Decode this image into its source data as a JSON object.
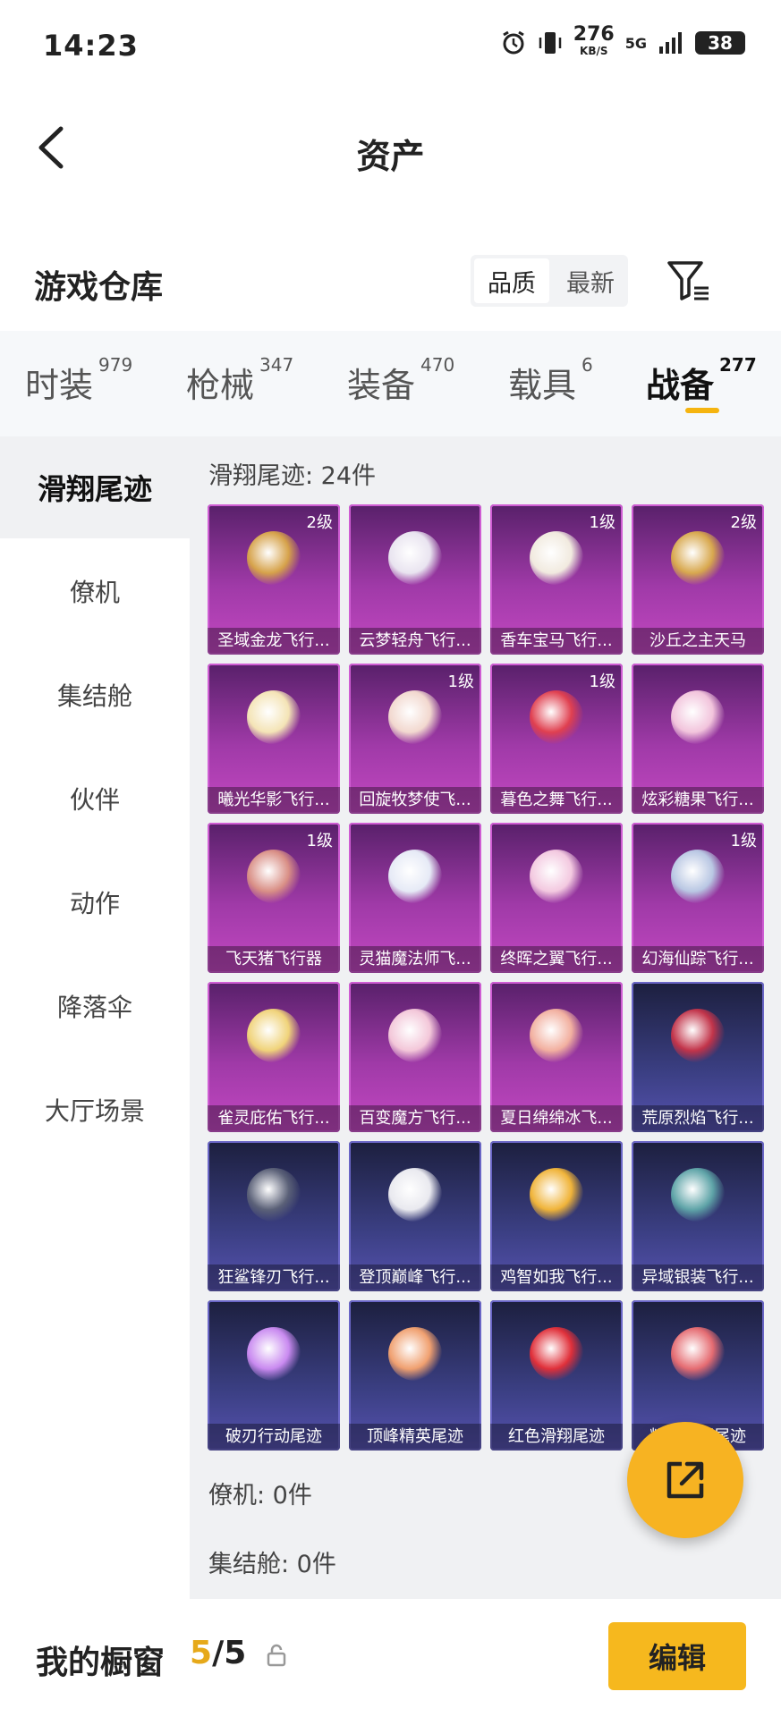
{
  "status_bar": {
    "time": "14:23",
    "net_speed": "276",
    "net_unit": "KB/S",
    "signal": "5G",
    "battery": "38"
  },
  "header": {
    "title": "资产"
  },
  "warehouse": {
    "title": "游戏仓库",
    "sort_options": [
      "品质",
      "最新"
    ],
    "sort_active": "品质"
  },
  "tabs": [
    {
      "label": "时装",
      "count": "979"
    },
    {
      "label": "枪械",
      "count": "347"
    },
    {
      "label": "装备",
      "count": "470"
    },
    {
      "label": "载具",
      "count": "6"
    },
    {
      "label": "战备",
      "count": "277"
    }
  ],
  "active_tab": "战备",
  "sidebar": [
    "滑翔尾迹",
    "僚机",
    "集结舱",
    "伙伴",
    "动作",
    "降落伞",
    "大厅场景"
  ],
  "sections": {
    "glide": "滑翔尾迹: 24件",
    "wingman": "僚机: 0件",
    "assembly": "集结舱: 0件"
  },
  "items": [
    {
      "name": "圣域金龙飞行...",
      "level": "2级",
      "rarity": "purple",
      "color": "#d6a24a"
    },
    {
      "name": "云梦轻舟飞行...",
      "level": "",
      "rarity": "purple",
      "color": "#e9e4f0"
    },
    {
      "name": "香车宝马飞行...",
      "level": "1级",
      "rarity": "purple",
      "color": "#f1eadf"
    },
    {
      "name": "沙丘之主天马",
      "level": "2级",
      "rarity": "purple",
      "color": "#d8a84e"
    },
    {
      "name": "曦光华影飞行...",
      "level": "",
      "rarity": "purple",
      "color": "#f4e4b6"
    },
    {
      "name": "回旋牧梦使飞...",
      "level": "1级",
      "rarity": "purple",
      "color": "#f2d8cf"
    },
    {
      "name": "暮色之舞飞行...",
      "level": "1级",
      "rarity": "purple",
      "color": "#e04050"
    },
    {
      "name": "炫彩糖果飞行...",
      "level": "",
      "rarity": "purple",
      "color": "#f2c4dc"
    },
    {
      "name": "飞天猪飞行器",
      "level": "1级",
      "rarity": "purple",
      "color": "#d98f86"
    },
    {
      "name": "灵猫魔法师飞...",
      "level": "",
      "rarity": "purple",
      "color": "#e6eaf6"
    },
    {
      "name": "终晖之翼飞行...",
      "level": "",
      "rarity": "purple",
      "color": "#f3c9e0"
    },
    {
      "name": "幻海仙踪飞行...",
      "level": "1级",
      "rarity": "purple",
      "color": "#b9c7e3"
    },
    {
      "name": "雀灵庇佑飞行...",
      "level": "",
      "rarity": "purple",
      "color": "#f0d37a"
    },
    {
      "name": "百变魔方飞行...",
      "level": "",
      "rarity": "purple",
      "color": "#f3c7d9"
    },
    {
      "name": "夏日绵绵冰飞...",
      "level": "",
      "rarity": "purple",
      "color": "#f2b0a0"
    },
    {
      "name": "荒原烈焰飞行...",
      "level": "",
      "rarity": "blue",
      "color": "#c2344a"
    },
    {
      "name": "狂鲨锋刃飞行...",
      "level": "",
      "rarity": "blue",
      "color": "#5b6178"
    },
    {
      "name": "登顶巅峰飞行...",
      "level": "",
      "rarity": "blue",
      "color": "#e9e9ef"
    },
    {
      "name": "鸡智如我飞行...",
      "level": "",
      "rarity": "blue",
      "color": "#f0b43a"
    },
    {
      "name": "异域银装飞行...",
      "level": "",
      "rarity": "blue",
      "color": "#5fa4a8"
    },
    {
      "name": "破刃行动尾迹",
      "level": "",
      "rarity": "blue",
      "color": "#c98af0"
    },
    {
      "name": "顶峰精英尾迹",
      "level": "",
      "rarity": "blue",
      "color": "#f0a070"
    },
    {
      "name": "红色滑翔尾迹",
      "level": "",
      "rarity": "blue",
      "color": "#e0303a"
    },
    {
      "name": "粉色滑翔尾迹",
      "level": "",
      "rarity": "blue",
      "color": "#e56c72"
    }
  ],
  "bottom_bar": {
    "label": "我的橱窗",
    "count_current": "5",
    "count_total": "/5",
    "edit_label": "编辑"
  },
  "icons": [
    "back-arrow-icon",
    "filter-icon",
    "lock-icon",
    "share-icon",
    "alarm-icon",
    "vibrate-icon",
    "signal-icon",
    "battery-icon"
  ],
  "colors": {
    "accent": "#f5b40f",
    "purple_card": "#a03aa8",
    "blue_card": "#3b3f83"
  }
}
